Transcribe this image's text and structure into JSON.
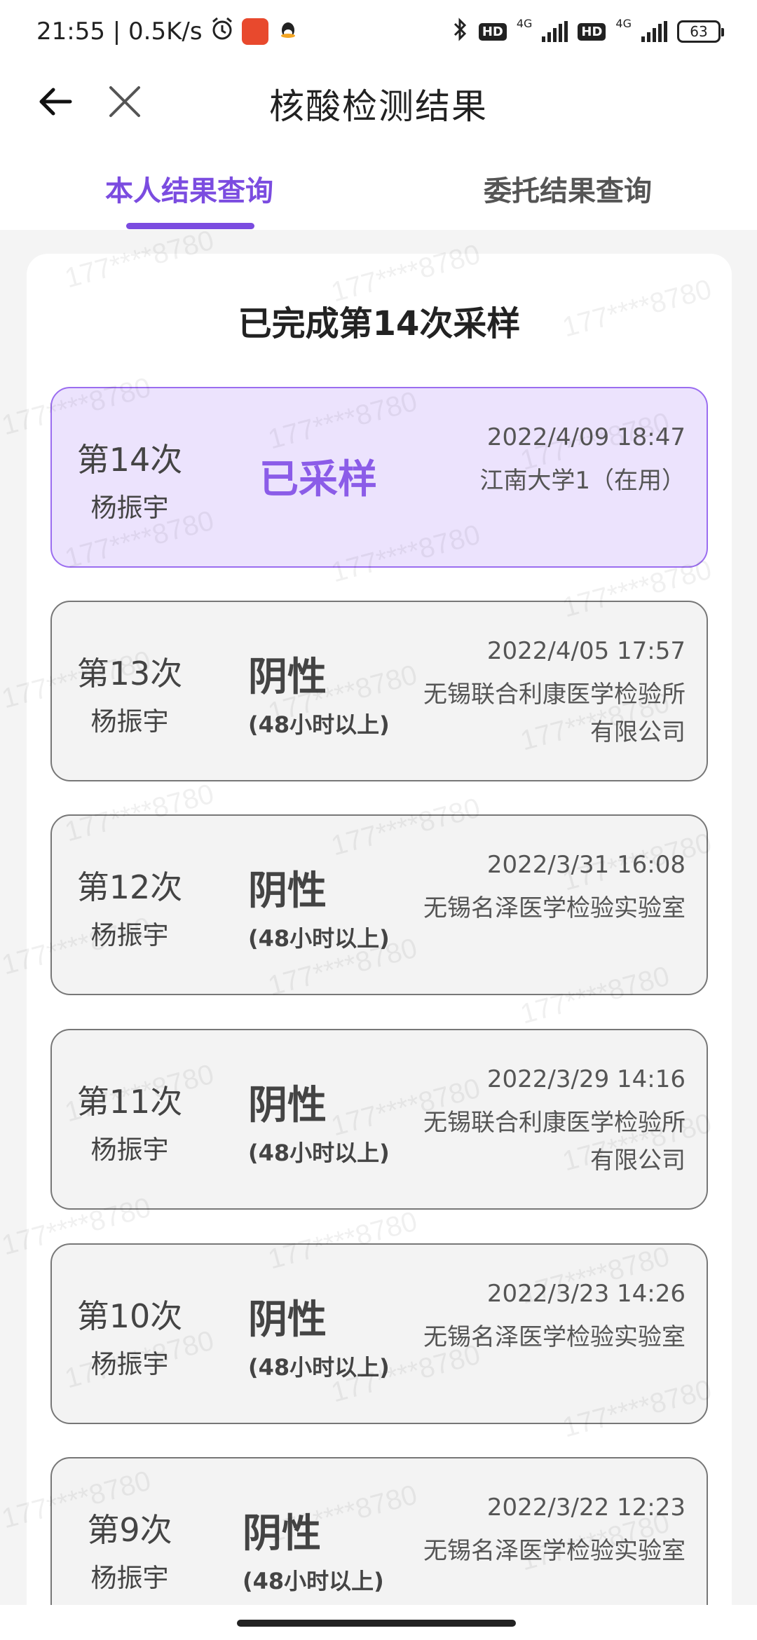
{
  "status_bar": {
    "time_speed": "21:55 | 0.5K/s",
    "network_1": "4G",
    "network_2": "4G",
    "hd": "HD",
    "battery": "63"
  },
  "header": {
    "title": "核酸检测结果"
  },
  "tabs": [
    {
      "label": "本人结果查询",
      "active": true
    },
    {
      "label": "委托结果查询",
      "active": false
    }
  ],
  "summary": {
    "title": "已完成第14次采样"
  },
  "watermark": "177****8780",
  "records": [
    {
      "num": "第14次",
      "name": "杨振宇",
      "status": "已采样",
      "sub": "",
      "time": "2022/4/09 18:47",
      "place": "江南大学1（在用）",
      "active": true
    },
    {
      "num": "第13次",
      "name": "杨振宇",
      "status": "阴性",
      "sub": "(48小时以上)",
      "time": "2022/4/05 17:57",
      "place": "无锡联合利康医学检验所有限公司",
      "active": false
    },
    {
      "num": "第12次",
      "name": "杨振宇",
      "status": "阴性",
      "sub": "(48小时以上)",
      "time": "2022/3/31 16:08",
      "place": "无锡名泽医学检验实验室",
      "active": false
    },
    {
      "num": "第11次",
      "name": "杨振宇",
      "status": "阴性",
      "sub": "(48小时以上)",
      "time": "2022/3/29 14:16",
      "place": "无锡联合利康医学检验所有限公司",
      "active": false
    },
    {
      "num": "第10次",
      "name": "杨振宇",
      "status": "阴性",
      "sub": "(48小时以上)",
      "time": "2022/3/23 14:26",
      "place": "无锡名泽医学检验实验室",
      "active": false
    },
    {
      "num": "第9次",
      "name": "杨振宇",
      "status": "阴性",
      "sub": "(48小时以上)",
      "time": "2022/3/22 12:23",
      "place": "无锡名泽医学检验实验室",
      "active": false
    }
  ]
}
